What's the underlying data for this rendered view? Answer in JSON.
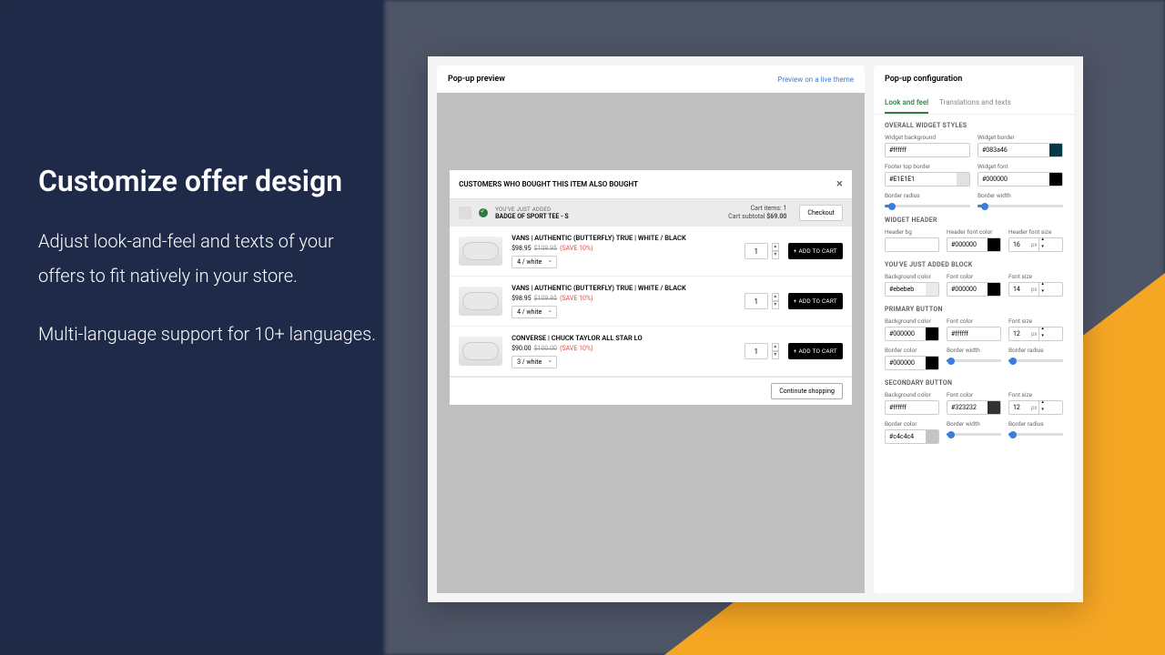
{
  "marketing": {
    "title": "Customize offer design",
    "para1": "Adjust look-and-feel and texts of your offers to fit natively in your store.",
    "para2": "Multi-language support for 10+ languages."
  },
  "preview": {
    "title": "Pop-up preview",
    "live_link": "Preview on a live theme"
  },
  "popup": {
    "header": "CUSTOMERS WHO BOUGHT THIS ITEM ALSO BOUGHT",
    "added_label": "YOU'VE JUST ADDED",
    "added_name": "BADGE OF SPORT TEE - S",
    "cart_items_label": "Cart items:",
    "cart_items": "1",
    "cart_subtotal_label": "Cart subtotal",
    "cart_subtotal": "$69.00",
    "checkout": "Checkout",
    "continue": "Continute shopping",
    "atc": "+ ADD TO CART",
    "products": [
      {
        "name": "VANS | AUTHENTIC (BUTTERFLY) TRUE | WHITE / BLACK",
        "price": "$98.95",
        "orig": "$109.95",
        "save": "(SAVE 10%)",
        "variant": "4 / white",
        "qty": "1"
      },
      {
        "name": "VANS | AUTHENTIC (BUTTERFLY) TRUE | WHITE / BLACK",
        "price": "$98.95",
        "orig": "$109.95",
        "save": "(SAVE 10%)",
        "variant": "4 / white",
        "qty": "1"
      },
      {
        "name": "CONVERSE | CHUCK TAYLOR ALL STAR LO",
        "price": "$90.00",
        "orig": "$100.00",
        "save": "(SAVE 10%)",
        "variant": "3 / white",
        "qty": "1"
      }
    ]
  },
  "config": {
    "title": "Pop-up configuration",
    "tabs": {
      "look": "Look and feel",
      "trans": "Translations and texts"
    },
    "sections": {
      "overall": {
        "title": "OVERALL WIDGET STYLES",
        "widget_bg_lbl": "Widget background",
        "widget_bg": "#ffffff",
        "widget_border_lbl": "Widget border",
        "widget_border": "#083a46",
        "footer_border_lbl": "Footer top border",
        "footer_border": "#E1E1E1",
        "widget_font_lbl": "Widget font",
        "widget_font": "#000000",
        "radius_lbl": "Border radius",
        "radius_pct": 8,
        "bwidth_lbl": "Border width",
        "bwidth_pct": 8
      },
      "header": {
        "title": "WIDGET HEADER",
        "bg_lbl": "Header bg",
        "bg": "",
        "color_lbl": "Header font color",
        "color": "#000000",
        "size_lbl": "Header font size",
        "size": "16"
      },
      "added": {
        "title": "YOU'VE JUST ADDED BLOCK",
        "bg_lbl": "Background color",
        "bg": "#ebebeb",
        "color_lbl": "Font color",
        "color": "#000000",
        "size_lbl": "Font size",
        "size": "14"
      },
      "primary": {
        "title": "PRIMARY BUTTON",
        "bg_lbl": "Background color",
        "bg": "#000000",
        "color_lbl": "Font color",
        "color": "#ffffff",
        "size_lbl": "Font size",
        "size": "12",
        "border_lbl": "Border color",
        "border": "#000000",
        "bwidth_lbl": "Border width",
        "bwidth_pct": 8,
        "radius_lbl": "Border radius",
        "radius_pct": 8
      },
      "secondary": {
        "title": "SECONDARY BUTTON",
        "bg_lbl": "Background color",
        "bg": "#ffffff",
        "color_lbl": "Font color",
        "color": "#323232",
        "size_lbl": "Font size",
        "size": "12",
        "border_lbl": "Border color",
        "border": "#c4c4c4",
        "bwidth_lbl": "Border width",
        "bwidth_pct": 8,
        "radius_lbl": "Border radius",
        "radius_pct": 8
      }
    },
    "px": "px"
  }
}
